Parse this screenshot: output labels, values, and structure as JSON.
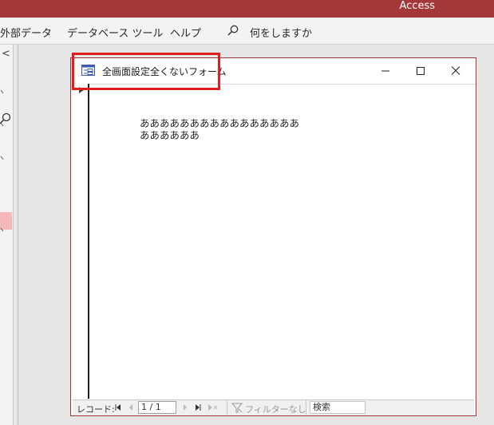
{
  "app": {
    "name": "Access"
  },
  "ribbon": {
    "tabs": [
      "外部データ",
      "データベース ツール",
      "ヘルプ"
    ],
    "tell_me": "何をしますか"
  },
  "nav_pane": {
    "collapse_glyph": "<"
  },
  "form": {
    "title": "全画面設定全くないフォーム",
    "content": "ああああああああああああああああああああああ",
    "record_nav": {
      "label": "レコード:",
      "position": "1 / 1",
      "filter_label": "フィルターなし",
      "search_label": "検索"
    }
  },
  "colors": {
    "accent": "#a4373a",
    "annotation": "#e11d1d"
  }
}
